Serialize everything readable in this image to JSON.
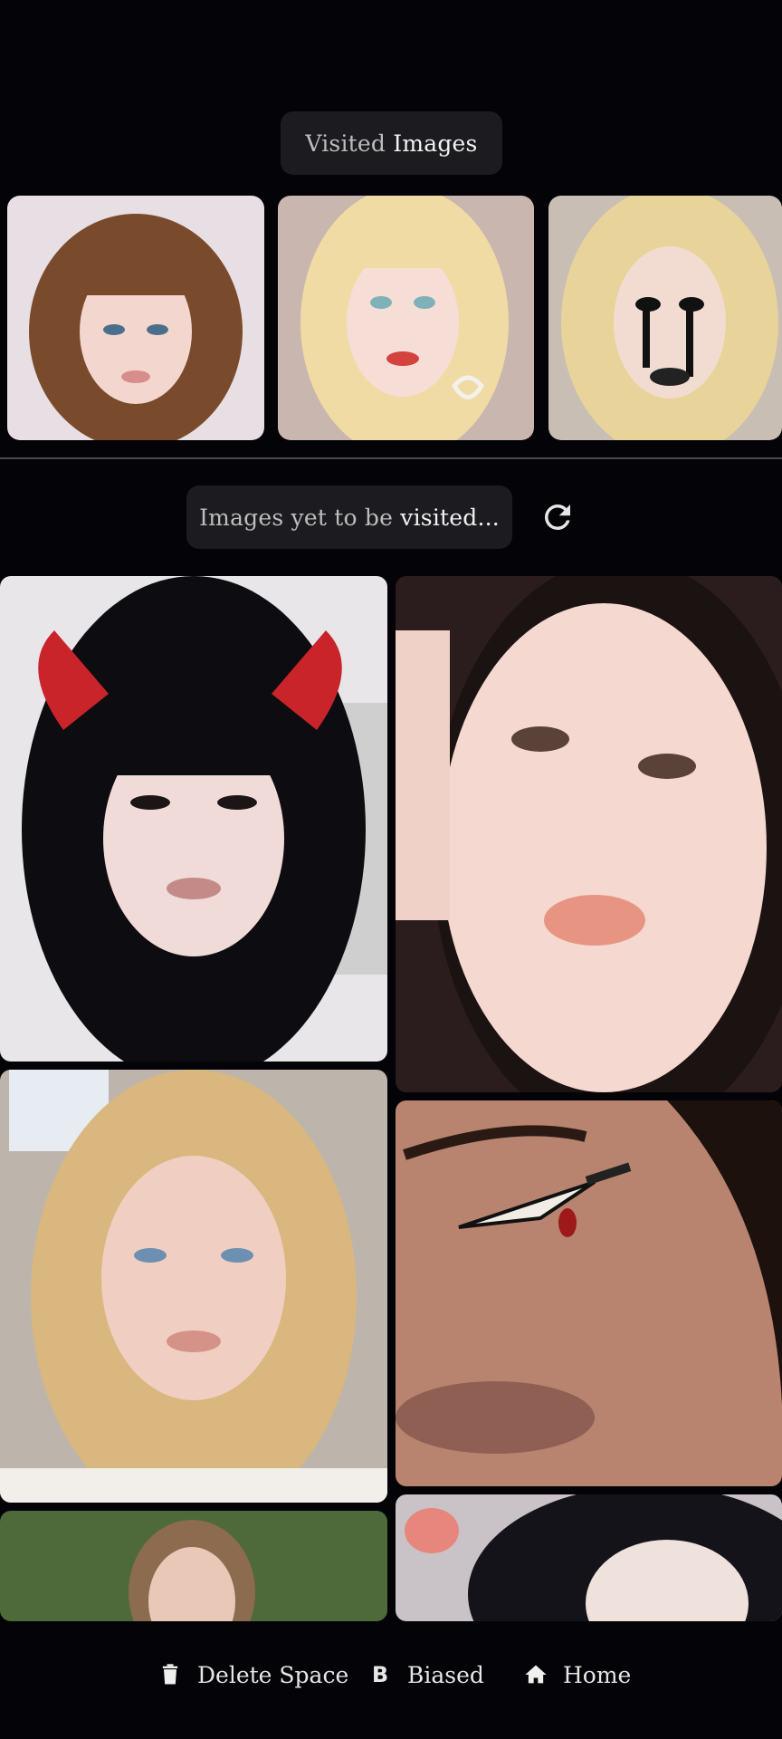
{
  "visited": {
    "label_part1": "Visited",
    "label_part2": "Images"
  },
  "pending": {
    "label_part1": "Images yet to be",
    "label_part2": "visited..."
  },
  "visited_images": [
    {
      "name": "visited-photo-1",
      "palette": {
        "bg": "#e8dfe4",
        "hair": "#7a4a2c",
        "skin": "#f3d7cf"
      }
    },
    {
      "name": "visited-photo-2",
      "palette": {
        "bg": "#c9b6ae",
        "hair": "#f0dba5",
        "skin": "#f6ded6"
      }
    },
    {
      "name": "visited-photo-3",
      "palette": {
        "bg": "#c8beb3",
        "hair": "#e8d49a",
        "skin": "#f2dcd2"
      }
    }
  ],
  "feed_images": [
    {
      "name": "feed-photo-devil-horns",
      "palette": {
        "bg": "#e9e6ea",
        "hair": "#0d0c10",
        "skin": "#f1dbd8"
      }
    },
    {
      "name": "feed-photo-closeup",
      "palette": {
        "bg": "#2b1d1d",
        "hair": "#1b1212",
        "skin": "#f5d8cf"
      }
    },
    {
      "name": "feed-photo-blonde",
      "palette": {
        "bg": "#bdb5ac",
        "hair": "#d9b77e",
        "skin": "#f0cfc2"
      }
    },
    {
      "name": "feed-photo-knife-eyeliner",
      "palette": {
        "bg": "#3a221c",
        "hair": "#1c110d",
        "skin": "#b88470"
      }
    },
    {
      "name": "feed-photo-outdoor",
      "palette": {
        "bg": "#4e6a3a",
        "hair": "#8c6b4e",
        "skin": "#e9c8b8"
      }
    },
    {
      "name": "feed-photo-dark-hair",
      "palette": {
        "bg": "#c9c3c8",
        "hair": "#15131a",
        "skin": "#efe1dc"
      }
    }
  ],
  "nav": {
    "delete_label": "Delete Space",
    "biased_label": "Biased",
    "biased_glyph": "B",
    "home_label": "Home"
  }
}
